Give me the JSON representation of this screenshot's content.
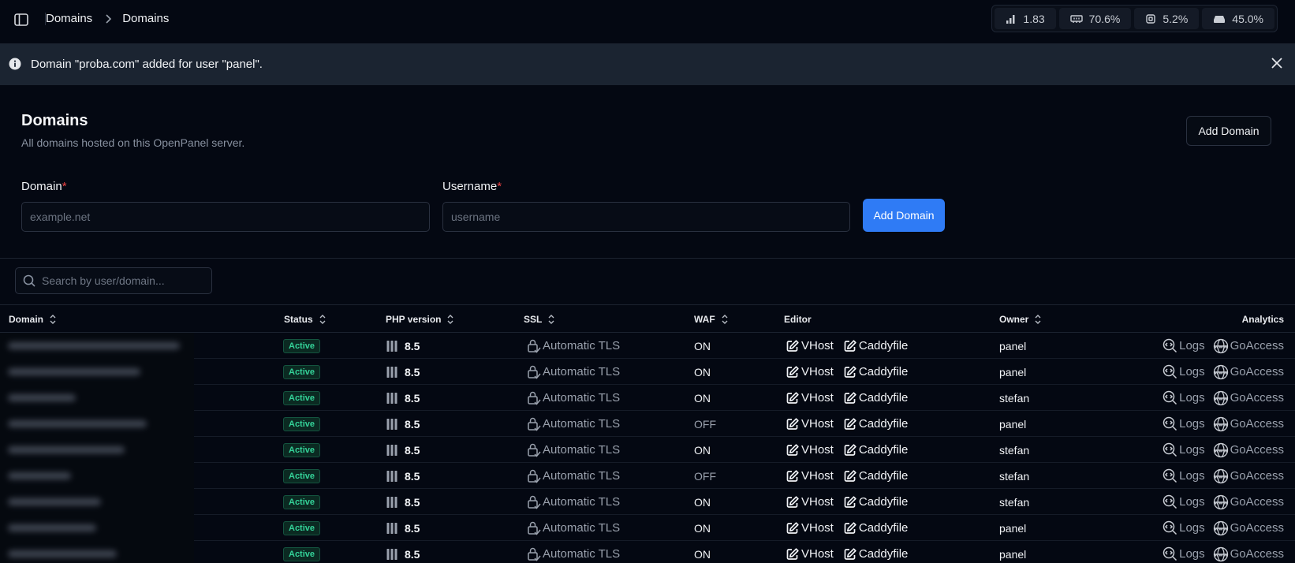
{
  "topbar": {
    "breadcrumb": [
      "Domains",
      "Domains"
    ],
    "metrics": [
      {
        "icon": "load-icon",
        "value": "1.83"
      },
      {
        "icon": "memory-icon",
        "value": "70.6%"
      },
      {
        "icon": "cpu-icon",
        "value": "5.2%"
      },
      {
        "icon": "disk-icon",
        "value": "45.0%"
      }
    ]
  },
  "alert": {
    "message": "Domain \"proba.com\" added for user \"panel\"."
  },
  "header": {
    "title": "Domains",
    "subtitle": "All domains hosted on this OpenPanel server.",
    "add_button": "Add Domain"
  },
  "form": {
    "domain_label": "Domain",
    "domain_placeholder": "example.net",
    "username_label": "Username",
    "username_placeholder": "username",
    "required_mark": "*",
    "submit": "Add Domain"
  },
  "search": {
    "placeholder": "Search by user/domain..."
  },
  "table": {
    "columns": {
      "domain": "Domain",
      "status": "Status",
      "php": "PHP version",
      "ssl": "SSL",
      "waf": "WAF",
      "editor": "Editor",
      "owner": "Owner",
      "analytics": "Analytics"
    },
    "editor_links": [
      "VHost",
      "Caddyfile"
    ],
    "analytics_links": [
      "Logs",
      "GoAccess"
    ],
    "rows": [
      {
        "status": "Active",
        "php": "8.5",
        "ssl": "Automatic TLS",
        "waf": "ON",
        "owner": "panel"
      },
      {
        "status": "Active",
        "php": "8.5",
        "ssl": "Automatic TLS",
        "waf": "ON",
        "owner": "panel"
      },
      {
        "status": "Active",
        "php": "8.5",
        "ssl": "Automatic TLS",
        "waf": "ON",
        "owner": "stefan"
      },
      {
        "status": "Active",
        "php": "8.5",
        "ssl": "Automatic TLS",
        "waf": "OFF",
        "owner": "panel"
      },
      {
        "status": "Active",
        "php": "8.5",
        "ssl": "Automatic TLS",
        "waf": "ON",
        "owner": "stefan"
      },
      {
        "status": "Active",
        "php": "8.5",
        "ssl": "Automatic TLS",
        "waf": "OFF",
        "owner": "stefan"
      },
      {
        "status": "Active",
        "php": "8.5",
        "ssl": "Automatic TLS",
        "waf": "ON",
        "owner": "stefan"
      },
      {
        "status": "Active",
        "php": "8.5",
        "ssl": "Automatic TLS",
        "waf": "ON",
        "owner": "panel"
      },
      {
        "status": "Active",
        "php": "8.5",
        "ssl": "Automatic TLS",
        "waf": "ON",
        "owner": "panel"
      }
    ]
  },
  "colors": {
    "primary": "#2f7bf5",
    "active_badge": "#34d399",
    "required": "#ef4444"
  }
}
